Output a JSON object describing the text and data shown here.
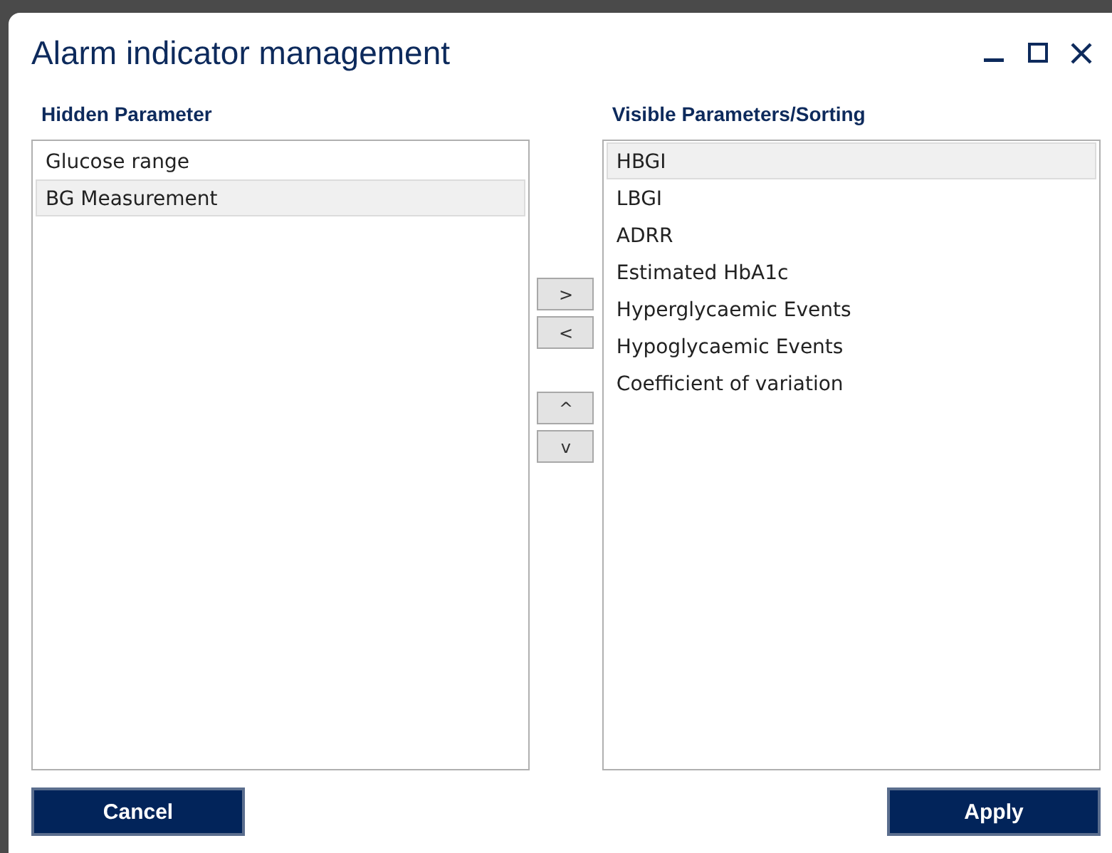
{
  "window": {
    "title": "Alarm indicator management"
  },
  "hidden": {
    "heading": "Hidden Parameter",
    "items": [
      {
        "label": "Glucose range",
        "selected": false
      },
      {
        "label": "BG Measurement",
        "selected": true
      }
    ]
  },
  "move_buttons": [
    ">",
    "<",
    "^",
    "v"
  ],
  "visible": {
    "heading": "Visible Parameters/Sorting",
    "items": [
      {
        "label": "HBGI",
        "selected": true
      },
      {
        "label": "LBGI",
        "selected": false
      },
      {
        "label": "ADRR",
        "selected": false
      },
      {
        "label": "Estimated HbA1c",
        "selected": false
      },
      {
        "label": "Hyperglycaemic Events",
        "selected": false
      },
      {
        "label": "Hypoglycaemic Events",
        "selected": false
      },
      {
        "label": "Coefficient of variation",
        "selected": false
      }
    ]
  },
  "buttons": {
    "cancel": "Cancel",
    "apply": "Apply"
  }
}
